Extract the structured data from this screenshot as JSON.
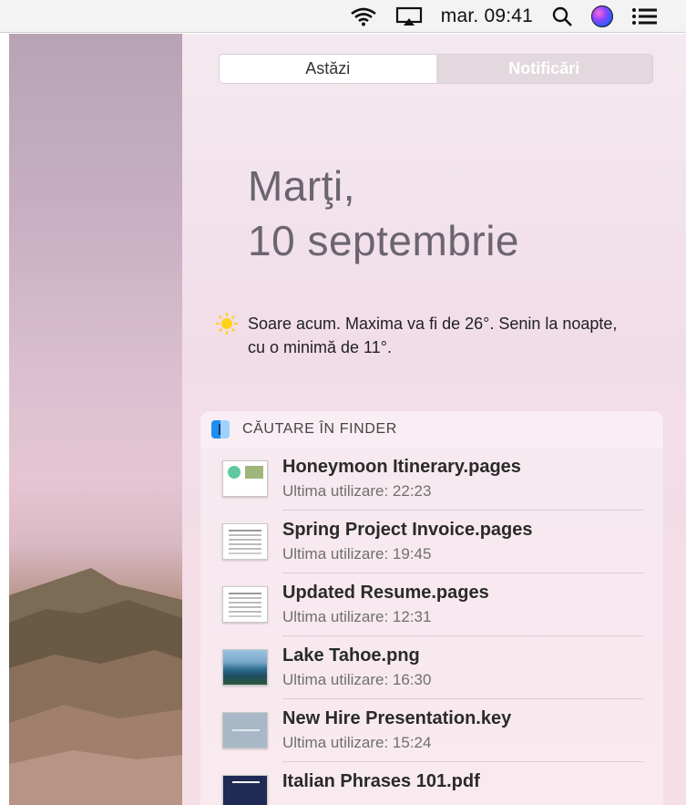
{
  "menubar": {
    "clock": "mar. 09:41",
    "icons": [
      "wifi-icon",
      "airplay-icon",
      "search-icon",
      "siri-icon",
      "notification-center-icon"
    ]
  },
  "panel": {
    "tabs": [
      {
        "label": "Astăzi",
        "active": true
      },
      {
        "label": "Notificări",
        "active": false
      }
    ],
    "date_line1": "Marţi,",
    "date_line2": "10 septembrie",
    "weather": {
      "icon": "sun-icon",
      "text": "Soare acum. Maxima va fi de 26°. Senin la noapte, cu o minimă de 11°."
    },
    "finder_widget": {
      "title": "CĂUTARE ÎN FINDER",
      "files": [
        {
          "name": "Honeymoon Itinerary.pages",
          "used": "Ultima utilizare: 22:23",
          "thumb": "itinerary"
        },
        {
          "name": "Spring Project Invoice.pages",
          "used": "Ultima utilizare: 19:45",
          "thumb": "doc"
        },
        {
          "name": "Updated Resume.pages",
          "used": "Ultima utilizare: 12:31",
          "thumb": "doc"
        },
        {
          "name": "Lake Tahoe.png",
          "used": "Ultima utilizare: 16:30",
          "thumb": "photo"
        },
        {
          "name": "New Hire Presentation.key",
          "used": "Ultima utilizare: 15:24",
          "thumb": "keynote"
        },
        {
          "name": "Italian Phrases 101.pdf",
          "used": "",
          "thumb": "pdf"
        }
      ]
    }
  }
}
